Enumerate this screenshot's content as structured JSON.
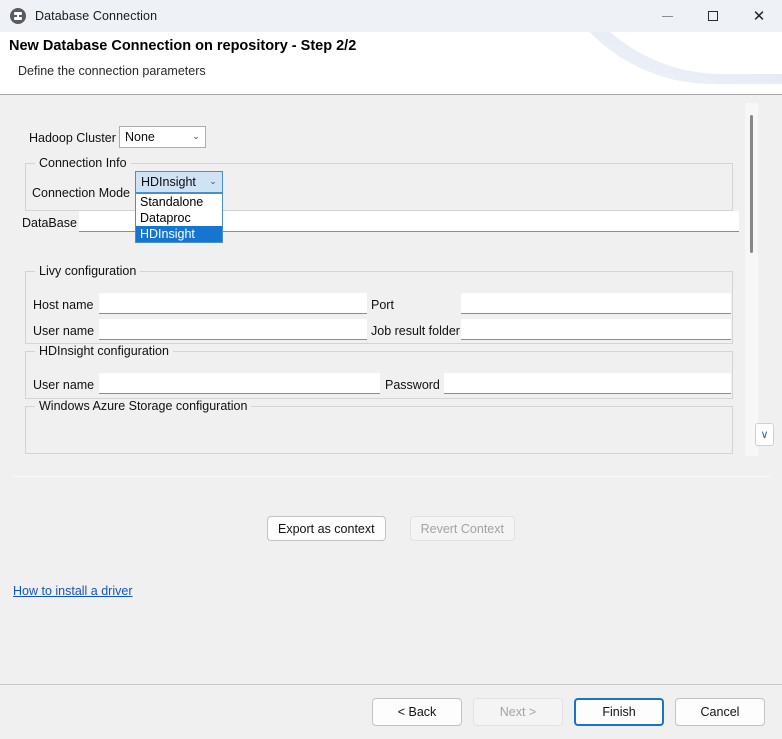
{
  "window": {
    "title": "Database Connection",
    "icon": "database-connection-icon",
    "controls": {
      "minimize": "minimize-icon",
      "maximize": "maximize-icon",
      "close": "close-icon"
    }
  },
  "banner": {
    "title": "New Database Connection on repository - Step 2/2",
    "subtitle": "Define the connection parameters"
  },
  "form": {
    "hadoop_cluster": {
      "label": "Hadoop Cluster",
      "value": "None",
      "chevron": "⌄"
    },
    "connection_info": {
      "group_title": "Connection Info",
      "connection_mode": {
        "label": "Connection Mode",
        "value": "HDInsight",
        "chevron": "⌄",
        "expanded": true,
        "options": [
          {
            "label": "Standalone",
            "selected": false
          },
          {
            "label": "Dataproc",
            "selected": false
          },
          {
            "label": "HDInsight",
            "selected": true
          }
        ]
      }
    },
    "database": {
      "label": "DataBase",
      "value": ""
    },
    "livy": {
      "group_title": "Livy configuration",
      "host_name": {
        "label": "Host name",
        "value": ""
      },
      "port": {
        "label": "Port",
        "value": ""
      },
      "user_name": {
        "label": "User name",
        "value": ""
      },
      "job_result_folder": {
        "label": "Job result folder",
        "value": ""
      }
    },
    "hdinsight": {
      "group_title": "HDInsight configuration",
      "user_name": {
        "label": "User name",
        "value": ""
      },
      "password": {
        "label": "Password",
        "value": ""
      }
    },
    "azure_storage": {
      "group_title": "Windows Azure Storage configuration"
    }
  },
  "scroll": {
    "expand_button": "∨"
  },
  "actions": {
    "export_as_context": {
      "label": "Export as context",
      "enabled": true
    },
    "revert_context": {
      "label": "Revert Context",
      "enabled": false
    },
    "driver_link": "How to install a driver"
  },
  "footer": {
    "back": {
      "label": "< Back",
      "enabled": true
    },
    "next": {
      "label": "Next >",
      "enabled": false
    },
    "finish": {
      "label": "Finish",
      "enabled": true,
      "default": true
    },
    "cancel": {
      "label": "Cancel",
      "enabled": true
    }
  },
  "colors": {
    "accent": "#1675d1",
    "link": "#1155cc",
    "default_button_border": "#1a73c4"
  }
}
